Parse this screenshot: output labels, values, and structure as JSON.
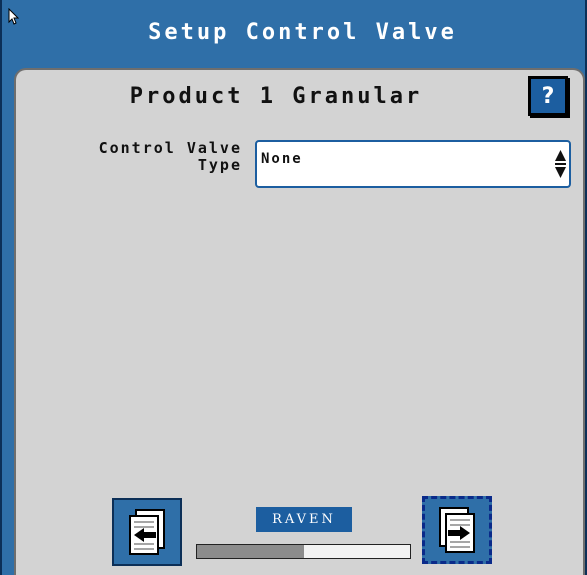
{
  "window": {
    "title": "Setup Control Valve"
  },
  "header": {
    "product_title": "Product 1 Granular",
    "help_label": "?"
  },
  "form": {
    "label_line1": "Control Valve",
    "label_line2": "Type",
    "control_valve_type": "None"
  },
  "footer": {
    "logo_text": "RAVEN",
    "progress": 0.5
  },
  "icons": {
    "back": "page-back-icon",
    "next": "page-next-icon",
    "select": "up-down-arrows-icon",
    "cursor": "mouse-cursor-icon"
  },
  "colors": {
    "title_bar": "#2f6fa8",
    "panel": "#d3d3d3",
    "accent": "#1c5ea0"
  }
}
